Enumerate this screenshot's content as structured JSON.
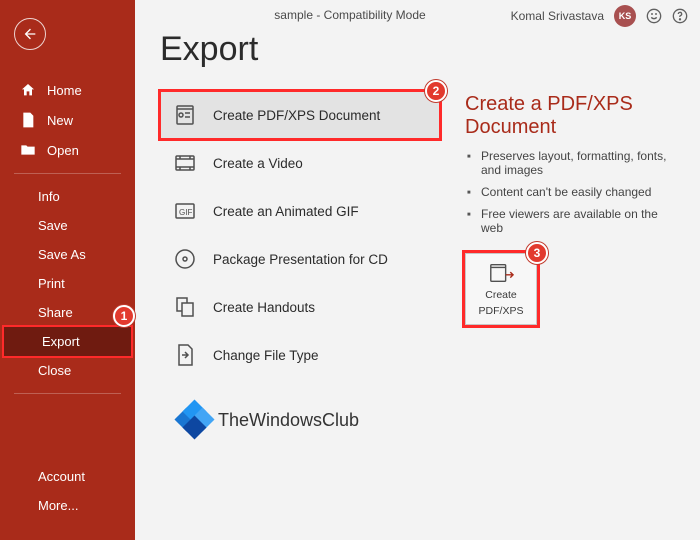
{
  "header": {
    "title_center": "sample  -  Compatibility Mode",
    "user_name": "Komal Srivastava",
    "user_initials": "KS"
  },
  "sidebar": {
    "items_top": [
      {
        "label": "Home",
        "icon": "home"
      },
      {
        "label": "New",
        "icon": "new"
      },
      {
        "label": "Open",
        "icon": "open"
      }
    ],
    "items_mid": [
      {
        "label": "Info"
      },
      {
        "label": "Save"
      },
      {
        "label": "Save As"
      },
      {
        "label": "Print"
      },
      {
        "label": "Share"
      },
      {
        "label": "Export",
        "active": true
      },
      {
        "label": "Close"
      }
    ],
    "items_bottom": [
      {
        "label": "Account"
      },
      {
        "label": "More..."
      }
    ]
  },
  "page": {
    "title": "Export",
    "options": [
      {
        "label": "Create PDF/XPS Document",
        "selected": true
      },
      {
        "label": "Create a Video"
      },
      {
        "label": "Create an Animated GIF"
      },
      {
        "label": "Package Presentation for CD"
      },
      {
        "label": "Create Handouts"
      },
      {
        "label": "Change File Type"
      }
    ],
    "details": {
      "title": "Create a PDF/XPS Document",
      "bullets": [
        "Preserves layout, formatting, fonts, and images",
        "Content can't be easily changed",
        "Free viewers are available on the web"
      ],
      "button_line1": "Create",
      "button_line2": "PDF/XPS"
    }
  },
  "annotations": {
    "a1": "1",
    "a2": "2",
    "a3": "3"
  },
  "watermark": "TheWindowsClub"
}
